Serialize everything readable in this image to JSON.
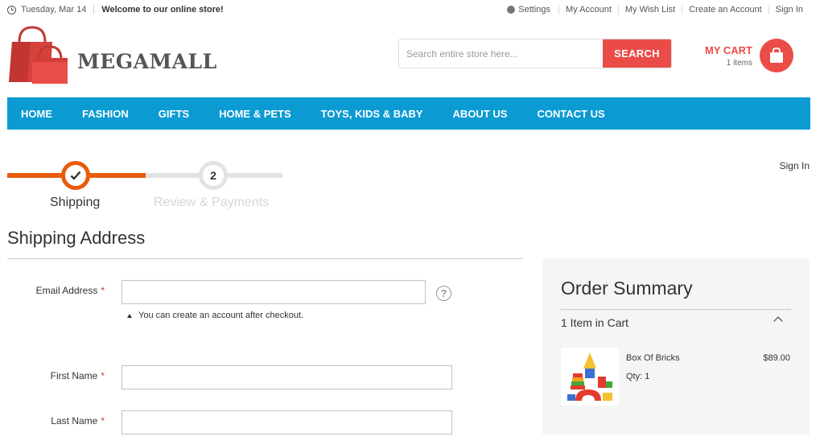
{
  "topbar": {
    "date": "Tuesday, Mar 14",
    "welcome": "Welcome to our online store!",
    "links": [
      "Settings",
      "My Account",
      "My Wish List",
      "Create an Account",
      "Sign In"
    ]
  },
  "logo": {
    "text": "MEGAMALL"
  },
  "search": {
    "placeholder": "Search entire store here...",
    "button": "SEARCH"
  },
  "cart": {
    "title": "MY CART",
    "count": "1 items"
  },
  "nav": [
    "HOME",
    "FASHION",
    "GIFTS",
    "HOME & PETS",
    "TOYS, KIDS & BABY",
    "ABOUT US",
    "CONTACT US"
  ],
  "signin": "Sign In",
  "progress": {
    "step1": {
      "label": "Shipping",
      "state": "complete"
    },
    "step2": {
      "number": "2",
      "label": "Review & Payments",
      "state": "inactive"
    }
  },
  "shipping": {
    "title": "Shipping Address",
    "email_label": "Email Address",
    "help": "?",
    "note": "You can create an account after checkout.",
    "first_name_label": "First Name",
    "last_name_label": "Last Name",
    "required_mark": "*"
  },
  "summary": {
    "title": "Order Summary",
    "items_in_cart": "1 Item in Cart",
    "product": {
      "name": "Box Of Bricks",
      "price": "$89.00",
      "qty": "Qty: 1"
    }
  },
  "colors": {
    "accent": "#ea4d48",
    "nav": "#0b9bd2",
    "progress": "#ea5b0c"
  }
}
